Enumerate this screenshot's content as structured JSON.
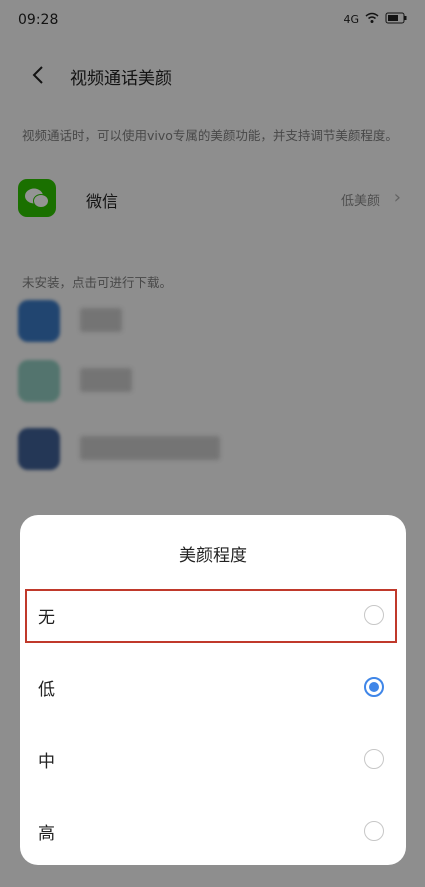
{
  "status_bar": {
    "time": "09:28",
    "icons": [
      "signal-icon",
      "wifi-icon",
      "battery-icon"
    ],
    "net": "4G"
  },
  "header": {
    "title": "视频通话美颜"
  },
  "description": "视频通话时，可以使用vivo专属的美颜功能，并支持调节美颜程度。",
  "installed_app": {
    "name": "微信",
    "beauty_level": "低美颜"
  },
  "uninstalled_notice": "未安装，点击可进行下载。",
  "sheet": {
    "title": "美颜程度",
    "options": [
      {
        "label": "无",
        "selected": false
      },
      {
        "label": "低",
        "selected": true
      },
      {
        "label": "中",
        "selected": false
      },
      {
        "label": "高",
        "selected": false
      }
    ]
  },
  "colors": {
    "accent": "#3f86e8",
    "highlight": "#c0392b",
    "wechat": "#2dc100"
  }
}
